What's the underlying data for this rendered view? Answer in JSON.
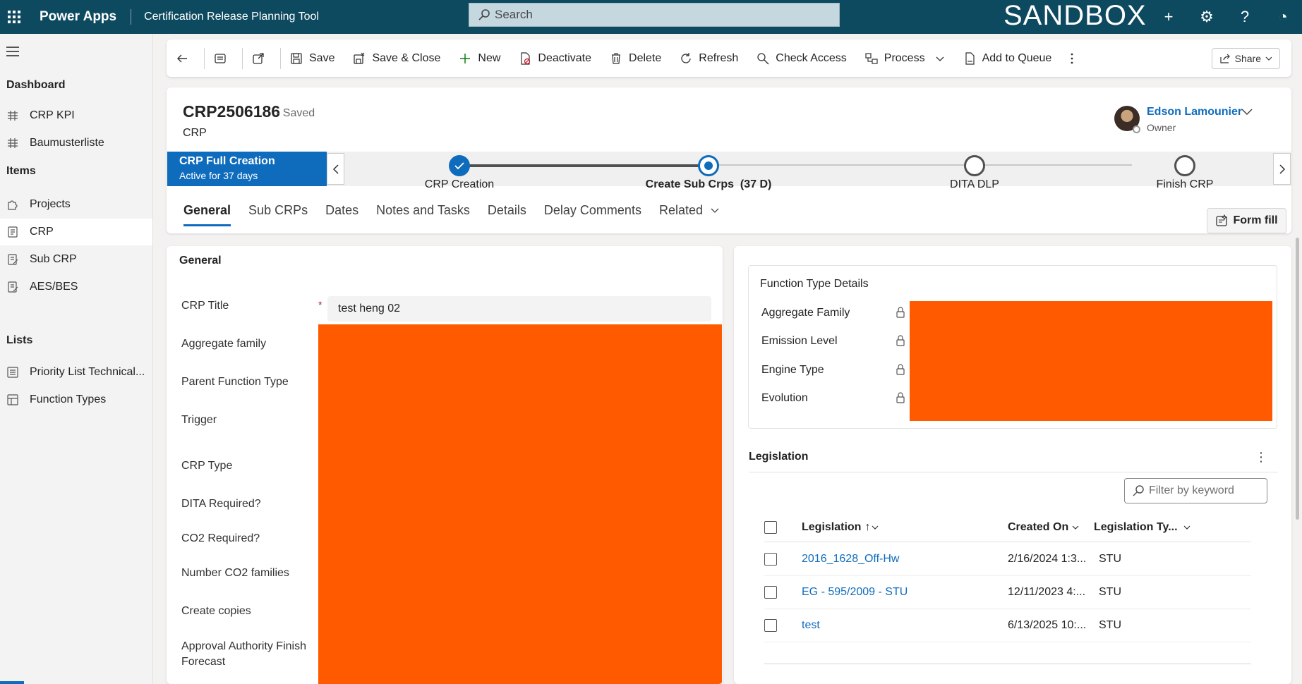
{
  "topbar": {
    "app_name": "Power Apps",
    "env_name": "Certification Release Planning Tool",
    "search_placeholder": "Search",
    "sandbox_label": "SANDBOX"
  },
  "nav": {
    "section_dashboard": "Dashboard",
    "dash_items": [
      "CRP KPI",
      "Baumusterliste"
    ],
    "section_items": "Items",
    "items": [
      "Projects",
      "CRP",
      "Sub CRP",
      "AES/BES"
    ],
    "section_lists": "Lists",
    "lists": [
      "Priority List Technical...",
      "Function Types"
    ]
  },
  "commands": {
    "save": "Save",
    "save_close": "Save & Close",
    "new": "New",
    "deactivate": "Deactivate",
    "delete": "Delete",
    "refresh": "Refresh",
    "check_access": "Check Access",
    "process": "Process",
    "add_to_queue": "Add to Queue",
    "share": "Share"
  },
  "record": {
    "id": "CRP2506186",
    "status": "- Saved",
    "entity": "CRP",
    "owner_name": "Edson Lamounier",
    "owner_role": "Owner"
  },
  "bpf": {
    "active_title": "CRP Full Creation",
    "active_sub": "Active for 37 days",
    "stages": [
      "CRP Creation",
      "Create Sub Crps  (37 D)",
      "DITA DLP",
      "Finish CRP"
    ]
  },
  "tabs": [
    "General",
    "Sub CRPs",
    "Dates",
    "Notes and Tasks",
    "Details",
    "Delay Comments",
    "Related"
  ],
  "form_fill": "Form fill",
  "general": {
    "title": "General",
    "fields": [
      "CRP Title",
      "Aggregate family",
      "Parent Function Type",
      "Trigger",
      "CRP Type",
      "DITA Required?",
      "CO2 Required?",
      "Number CO2 families",
      "Create copies",
      "Approval Authority Finish Forecast"
    ],
    "crp_title_value": "test heng 02",
    "required_marker": "*"
  },
  "function_type": {
    "title": "Function Type Details",
    "fields": [
      "Aggregate Family",
      "Emission Level",
      "Engine Type",
      "Evolution"
    ]
  },
  "legislation": {
    "title": "Legislation",
    "filter_placeholder": "Filter by keyword",
    "columns": [
      "Legislation",
      "Created On",
      "Legislation Ty..."
    ],
    "rows": [
      {
        "name": "2016_1628_Off-Hw",
        "created": "2/16/2024 1:3...",
        "type": "STU"
      },
      {
        "name": "EG - 595/2009 - STU",
        "created": "12/11/2023 4:...",
        "type": "STU"
      },
      {
        "name": "test",
        "created": "6/13/2025 10:...",
        "type": "STU"
      }
    ]
  },
  "colors": {
    "topbar": "#0e4a5f",
    "accent": "#0f6cbd",
    "redaction": "#ff5a00"
  }
}
